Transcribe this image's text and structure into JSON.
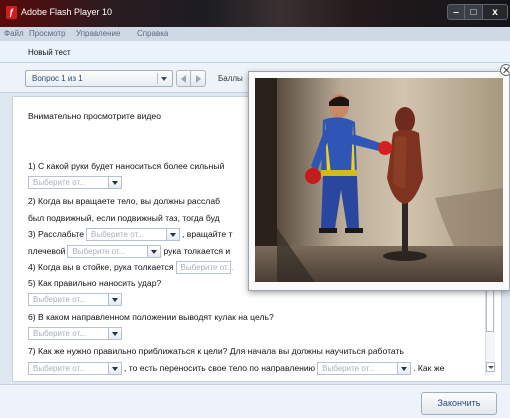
{
  "window": {
    "title": "Adobe Flash Player 10",
    "buttons": {
      "minimize": "–",
      "maximize": "□",
      "close": "x"
    }
  },
  "menu": [
    "Файл",
    "Просмотр",
    "Управление",
    "Справка"
  ],
  "test_name": "Новый тест",
  "toolbar": {
    "question_select": "Вопрос 1 из 1",
    "score_label": "Баллы"
  },
  "instruction": "Внимательно просмотрите видео",
  "dropdown_placeholder": "Выберите от...",
  "lines": {
    "q1": "1) С какой руки будет наноситься более сильный",
    "q2a": "2) Когда вы вращаете тело, вы должны расслаб",
    "q2b": "был подвижный, если подвижный таз, тогда буд",
    "q3a_1": "3) Расслабьте",
    "q3a_2": ", вращайте т",
    "q3b_1": "плечевой",
    "q3b_2": "рука толкается и",
    "q4": "4) Когда вы в стойке, рука толкается",
    "q5": "5) Как правильно наносить удар?",
    "q6": "6) В каком направленном положении выводят кулак на цель?",
    "q7a": "7) Как же нужно правильно приближаться к цели? Для начала вы должны научиться работать",
    "q7b_1": ", то есть переносить свое тело по направлению",
    "q7b_2": ". Как же"
  },
  "finish_button": "Закончить",
  "video": {
    "description_icon": "video-frame"
  }
}
